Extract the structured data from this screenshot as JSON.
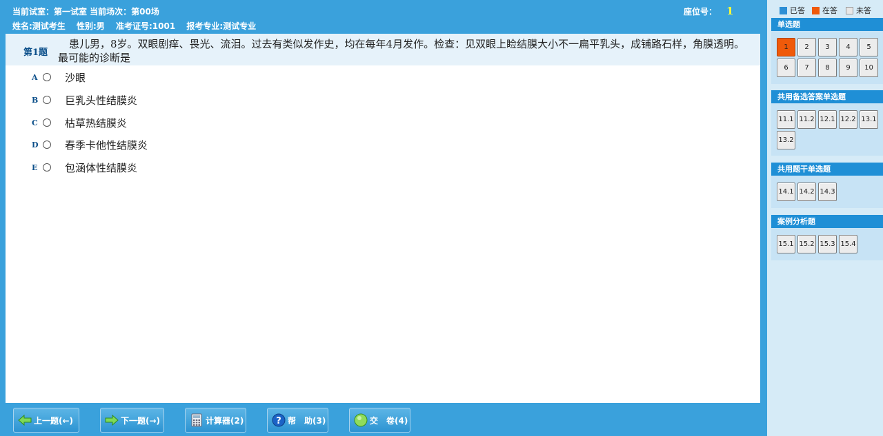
{
  "header": {
    "line1": "当前试室：第一试室 当前场次：第00场",
    "name": "姓名:测试考生",
    "gender": "性别:男",
    "ticket": "准考证号:1001",
    "major": "报考专业:测试专业",
    "seat_label": "座位号：",
    "seat_value": "1"
  },
  "question": {
    "number": "第1题",
    "text": "患儿男，8岁。双眼剧痒、畏光、流泪。过去有类似发作史，均在每年4月发作。检查：见双眼上睑结膜大小不一扁平乳头，成铺路石样，角膜透明。最可能的诊断是",
    "options": [
      {
        "letter": "A",
        "text": "沙眼"
      },
      {
        "letter": "B",
        "text": "巨乳头性结膜炎"
      },
      {
        "letter": "C",
        "text": "枯草热结膜炎"
      },
      {
        "letter": "D",
        "text": "春季卡他性结膜炎"
      },
      {
        "letter": "E",
        "text": "包涵体性结膜炎"
      }
    ]
  },
  "buttons": {
    "prev": "上一题(←)",
    "next": "下一题(→)",
    "calc": "计算器(2)",
    "help": "帮　助(3)",
    "submit": "交　卷(4)"
  },
  "legend": {
    "answered": "已答",
    "current": "在答",
    "unanswered": "未答",
    "answered_color": "#2d8fd5",
    "current_color": "#f05a0a",
    "unanswered_color": "#e8e8e8"
  },
  "sections": [
    {
      "title": "单选题",
      "items": [
        "1",
        "2",
        "3",
        "4",
        "5",
        "6",
        "7",
        "8",
        "9",
        "10"
      ],
      "current": "1"
    },
    {
      "title": "共用备选答案单选题",
      "items": [
        "11.1",
        "11.2",
        "12.1",
        "12.2",
        "13.1",
        "13.2"
      ]
    },
    {
      "title": "共用题干单选题",
      "items": [
        "14.1",
        "14.2",
        "14.3"
      ]
    },
    {
      "title": "案例分析题",
      "items": [
        "15.1",
        "15.2",
        "15.3",
        "15.4"
      ]
    }
  ]
}
